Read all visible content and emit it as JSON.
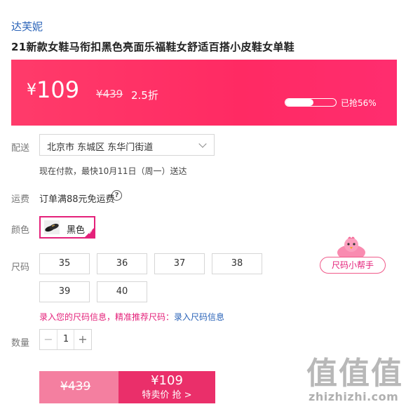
{
  "product": {
    "brand": "达芙妮",
    "title": "21新款女鞋马衔扣黑色亮面乐福鞋女舒适百搭小皮鞋女单鞋"
  },
  "price_banner": {
    "currency": "¥",
    "price": "109",
    "original_price": "¥439",
    "discount": "2.5折",
    "sold_text": "已抢56%",
    "sold_fraction": 0.56
  },
  "delivery": {
    "label": "配送",
    "address": "北京市 东城区 东华门街道",
    "note": "现在付款，最快10月11日（周一）送达"
  },
  "shipping": {
    "label": "运费",
    "text": "订单满88元免运费",
    "help_icon": "?"
  },
  "color": {
    "label": "颜色",
    "selected": "黑色"
  },
  "size": {
    "label": "尺码",
    "options": [
      "35",
      "36",
      "37",
      "38",
      "39",
      "40"
    ],
    "helper_button": "尺码小帮手"
  },
  "size_hint": {
    "prompt": "录入您的尺码信息，精准推荐尺码：",
    "link": "录入尺码信息"
  },
  "quantity": {
    "label": "数量",
    "minus": "−",
    "value": "1",
    "plus": "+"
  },
  "buy": {
    "original_price": "¥439",
    "sale_price": "¥109",
    "cta": "特卖价 抢 >"
  },
  "watermark": {
    "logo": "值值值",
    "url": "zhizhizhi.com"
  },
  "colors": {
    "accent": "#ff2a63",
    "link": "#2a63b8",
    "pink": "#e4217a"
  }
}
